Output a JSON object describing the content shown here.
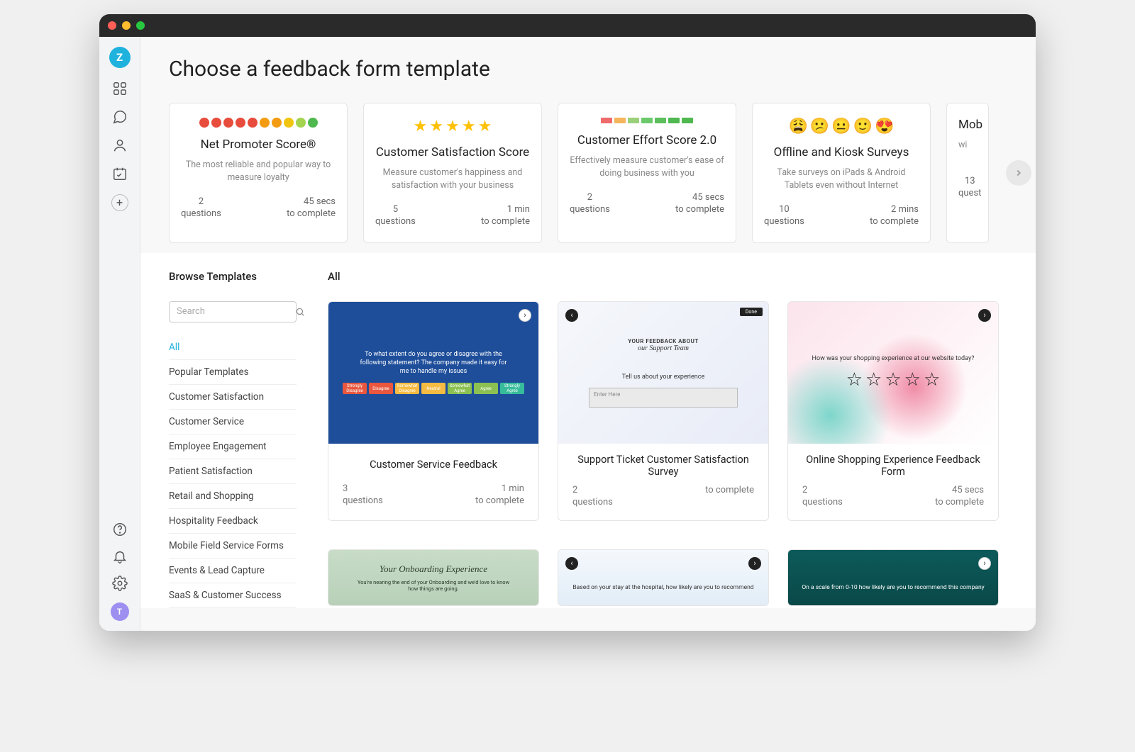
{
  "sidenav": {
    "logo_letter": "Z",
    "add_label": "+",
    "avatar_letter": "T"
  },
  "page_title": "Choose a feedback form template",
  "type_cards": [
    {
      "title": "Net Promoter Score®",
      "desc": "The most reliable and popular way to measure loyalty",
      "q_count": "2",
      "q_label": "questions",
      "time": "45 secs",
      "time_label": "to complete",
      "icon": "nps"
    },
    {
      "title": "Customer Satisfaction Score",
      "desc": "Measure customer's happiness and satisfaction with your business",
      "q_count": "5",
      "q_label": "questions",
      "time": "1 min",
      "time_label": "to complete",
      "icon": "stars"
    },
    {
      "title": "Customer Effort Score 2.0",
      "desc": "Effectively measure customer's ease of doing business with you",
      "q_count": "2",
      "q_label": "questions",
      "time": "45 secs",
      "time_label": "to complete",
      "icon": "ces"
    },
    {
      "title": "Offline and Kiosk Surveys",
      "desc": "Take surveys on iPads & Android Tablets even without Internet",
      "q_count": "10",
      "q_label": "questions",
      "time": "2 mins",
      "time_label": "to complete",
      "icon": "emoji"
    },
    {
      "title": "Mob",
      "desc": "wi",
      "q_count": "13",
      "q_label": "quest",
      "time": "",
      "time_label": "",
      "icon": "partial"
    }
  ],
  "browse": {
    "heading": "Browse Templates",
    "all_heading": "All",
    "search_placeholder": "Search",
    "categories": [
      "All",
      "Popular Templates",
      "Customer Satisfaction",
      "Customer Service",
      "Employee Engagement",
      "Patient Satisfaction",
      "Retail and Shopping",
      "Hospitality Feedback",
      "Mobile Field Service Forms",
      "Events & Lead Capture",
      "SaaS & Customer Success"
    ],
    "templates": [
      {
        "name": "Customer Service Feedback",
        "q_count": "3",
        "q_label": "questions",
        "time": "1 min",
        "time_label": "to complete",
        "preview": {
          "style": "blue-likert",
          "question": "To what extent do you agree or disagree with the following statement? The company made it easy for me to handle my issues",
          "options": [
            "Strongly Disagree",
            "Disagree",
            "Somewhat Disagree",
            "Neutral",
            "Somewhat Agree",
            "Agree",
            "Strongly Agree"
          ]
        }
      },
      {
        "name": "Support Ticket Customer Satisfaction Survey",
        "q_count": "2",
        "q_label": "questions",
        "time": "",
        "time_label": "to complete",
        "preview": {
          "style": "white-text",
          "header1": "YOUR FEEDBACK ABOUT",
          "header2": "our Support Team",
          "question": "Tell us about your experience",
          "placeholder": "Enter Here"
        }
      },
      {
        "name": "Online Shopping Experience Feedback Form",
        "q_count": "2",
        "q_label": "questions",
        "time": "45 secs",
        "time_label": "to complete",
        "preview": {
          "style": "pink-stars",
          "question": "How was your shopping experience at our website today?"
        }
      }
    ],
    "templates_row2": [
      {
        "preview": {
          "style": "green-script",
          "title": "Your Onboarding Experience",
          "sub": "You're nearing the end of your Onboarding and we'd love to know how things are going."
        }
      },
      {
        "preview": {
          "style": "hex-blue",
          "question": "Based on your stay at the hospital, how likely are you to recommend"
        }
      },
      {
        "preview": {
          "style": "teal-dark",
          "question": "On a scale from 0-10 how likely are you to recommend this company"
        }
      }
    ]
  },
  "colors": {
    "nps": [
      "#e74c3c",
      "#e74c3c",
      "#e74c3c",
      "#e74c3c",
      "#e74c3c",
      "#f39c12",
      "#f39c12",
      "#f1c40f",
      "#a3d34f",
      "#4fb84f"
    ],
    "ces": [
      "#ef6a6a",
      "#f5b55a",
      "#9ad07a",
      "#6bc96b",
      "#5cbf5c",
      "#4fb84f",
      "#4fb84f"
    ],
    "likert": [
      "#e9573f",
      "#e9573f",
      "#f6bb42",
      "#f6bb42",
      "#8cc152",
      "#8cc152",
      "#37bc9b"
    ],
    "emoji": [
      "😩",
      "😕",
      "😐",
      "🙂",
      "😍"
    ]
  }
}
